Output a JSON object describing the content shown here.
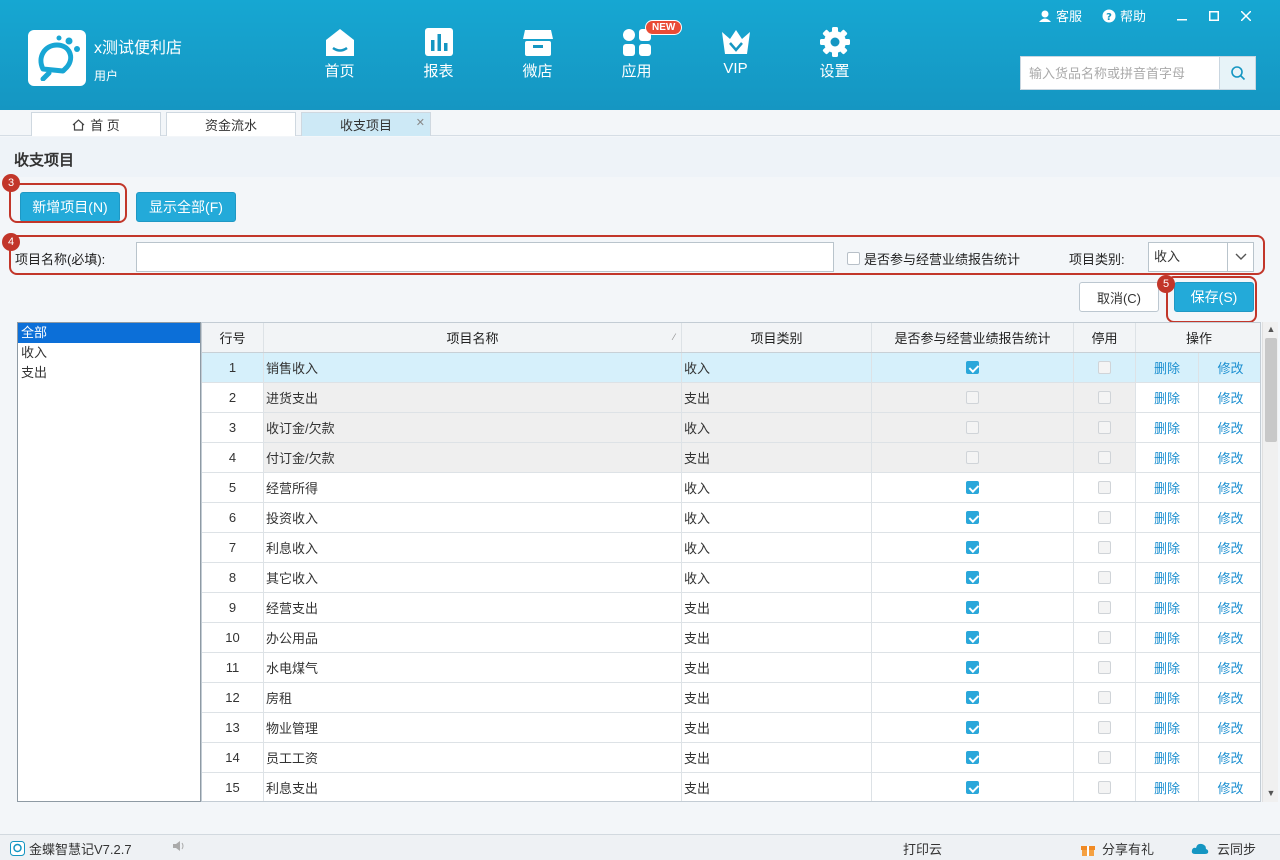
{
  "app": {
    "store_name": "x测试便利店",
    "user": "用户"
  },
  "nav": [
    {
      "label": "首页",
      "icon": "home-icon"
    },
    {
      "label": "报表",
      "icon": "bar-chart-icon"
    },
    {
      "label": "微店",
      "icon": "store-icon"
    },
    {
      "label": "应用",
      "icon": "apps-icon",
      "badge": "NEW"
    },
    {
      "label": "VIP",
      "icon": "vip-crown-icon"
    },
    {
      "label": "设置",
      "icon": "gear-icon"
    }
  ],
  "top_links": {
    "service": "客服",
    "help": "帮助"
  },
  "search": {
    "placeholder": "输入货品名称或拼音首字母"
  },
  "tabs": [
    {
      "label": "首 页"
    },
    {
      "label": "资金流水"
    },
    {
      "label": "收支项目"
    }
  ],
  "page": {
    "title": "收支项目"
  },
  "toolbar": {
    "add_label": "新增项目(N)",
    "show_all_label": "显示全部(F)",
    "cancel_label": "取消(C)",
    "save_label": "保存(S)"
  },
  "annotations": [
    "3",
    "4",
    "5"
  ],
  "form": {
    "name_label": "项目名称(必填):",
    "name_value": "",
    "stat_label": "是否参与经营业绩报告统计",
    "type_label": "项目类别:",
    "type_value": "收入"
  },
  "tree": [
    "全部",
    "收入",
    "支出"
  ],
  "grid": {
    "columns": [
      "行号",
      "项目名称",
      "项目类别",
      "是否参与经营业绩报告统计",
      "停用",
      "操作"
    ],
    "delete_label": "删除",
    "edit_label": "修改",
    "rows": [
      {
        "no": "1",
        "name": "销售收入",
        "type": "收入",
        "stat": true,
        "disabled": false
      },
      {
        "no": "2",
        "name": "进货支出",
        "type": "支出",
        "stat": false,
        "disabled": false
      },
      {
        "no": "3",
        "name": "收订金/欠款",
        "type": "收入",
        "stat": false,
        "disabled": false
      },
      {
        "no": "4",
        "name": "付订金/欠款",
        "type": "支出",
        "stat": false,
        "disabled": false
      },
      {
        "no": "5",
        "name": "经营所得",
        "type": "收入",
        "stat": true,
        "disabled": false
      },
      {
        "no": "6",
        "name": "投资收入",
        "type": "收入",
        "stat": true,
        "disabled": false
      },
      {
        "no": "7",
        "name": "利息收入",
        "type": "收入",
        "stat": true,
        "disabled": false
      },
      {
        "no": "8",
        "name": "其它收入",
        "type": "收入",
        "stat": true,
        "disabled": false
      },
      {
        "no": "9",
        "name": "经营支出",
        "type": "支出",
        "stat": true,
        "disabled": false
      },
      {
        "no": "10",
        "name": "办公用品",
        "type": "支出",
        "stat": true,
        "disabled": false
      },
      {
        "no": "11",
        "name": "水电煤气",
        "type": "支出",
        "stat": true,
        "disabled": false
      },
      {
        "no": "12",
        "name": "房租",
        "type": "支出",
        "stat": true,
        "disabled": false
      },
      {
        "no": "13",
        "name": "物业管理",
        "type": "支出",
        "stat": true,
        "disabled": false
      },
      {
        "no": "14",
        "name": "员工工资",
        "type": "支出",
        "stat": true,
        "disabled": false
      },
      {
        "no": "15",
        "name": "利息支出",
        "type": "支出",
        "stat": true,
        "disabled": false
      }
    ]
  },
  "status": {
    "version": "金蝶智慧记V7.2.7",
    "print": "打印云",
    "share": "分享有礼",
    "sync": "云同步"
  },
  "colors": {
    "header": "#1596c2",
    "accent": "#23aad9",
    "annotation": "#c2362a",
    "link": "#1c8fd0"
  }
}
